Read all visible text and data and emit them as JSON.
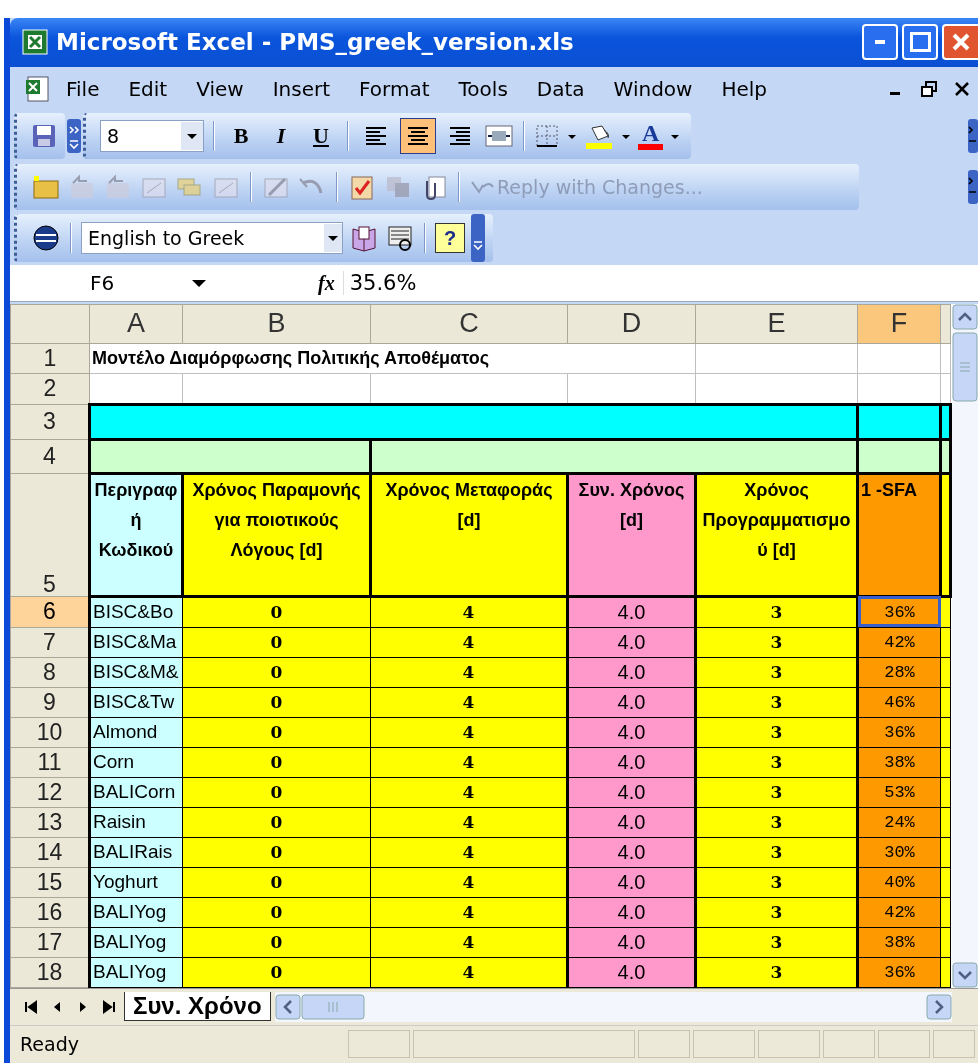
{
  "window": {
    "title": "Microsoft Excel - PMS_greek_version.xls"
  },
  "menu": [
    {
      "label": "File"
    },
    {
      "label": "Edit"
    },
    {
      "label": "View"
    },
    {
      "label": "Insert"
    },
    {
      "label": "Format"
    },
    {
      "label": "Tools"
    },
    {
      "label": "Data"
    },
    {
      "label": "Window"
    },
    {
      "label": "Help"
    }
  ],
  "formatting_toolbar": {
    "font_size": "8",
    "bold": "B",
    "italic": "I",
    "underline": "U",
    "alignment": [
      {
        "kind": "left",
        "selected": false
      },
      {
        "kind": "center",
        "selected": true
      },
      {
        "kind": "right",
        "selected": false
      }
    ],
    "font_color": "A"
  },
  "reviewing_toolbar": {
    "reply_button": {
      "label": "Reply with Changes...",
      "disabled": true
    }
  },
  "translation_toolbar": {
    "direction": "English to Greek",
    "help": "?"
  },
  "formula_bar": {
    "name_box": "F6",
    "fx": "fx",
    "formula": "35.6%"
  },
  "columns": [
    {
      "label": "A",
      "selected": false,
      "color": "#ccffff"
    },
    {
      "label": "B",
      "selected": false,
      "color": "#ffff00"
    },
    {
      "label": "C",
      "selected": false,
      "color": "#ffff00"
    },
    {
      "label": "D",
      "selected": false,
      "color": "#ff99cc"
    },
    {
      "label": "E",
      "selected": false,
      "color": "#ffff00"
    },
    {
      "label": "F",
      "selected": true,
      "color": "#ff9900"
    }
  ],
  "sheet_title": {
    "row": "1",
    "text": "Μοντέλο Διαμόρφωσης Πολιτικής Αποθέματος"
  },
  "blank_rows": [
    "2",
    "3",
    "4"
  ],
  "header_row": {
    "row": "5",
    "cells": [
      "Περιγραφή Κωδικού",
      "Χρόνος Παραμονής για ποιοτικούς Λόγους [d]",
      "Χρόνος Μεταφοράς [d]",
      "Συν. Χρόνος [d]",
      "Χρόνος Προγραμματισμού [d]",
      "1 -SFA"
    ]
  },
  "rows": [
    {
      "row": "6",
      "selected": true,
      "cells": [
        "BISC&Bo",
        "0",
        "4",
        "4.0",
        "3",
        "36%"
      ]
    },
    {
      "row": "7",
      "selected": false,
      "cells": [
        "BISC&Ma",
        "0",
        "4",
        "4.0",
        "3",
        "42%"
      ]
    },
    {
      "row": "8",
      "selected": false,
      "cells": [
        "BISC&M&",
        "0",
        "4",
        "4.0",
        "3",
        "28%"
      ]
    },
    {
      "row": "9",
      "selected": false,
      "cells": [
        "BISC&Tw",
        "0",
        "4",
        "4.0",
        "3",
        "46%"
      ]
    },
    {
      "row": "10",
      "selected": false,
      "cells": [
        "Almond",
        "0",
        "4",
        "4.0",
        "3",
        "36%"
      ]
    },
    {
      "row": "11",
      "selected": false,
      "cells": [
        "Corn",
        "0",
        "4",
        "4.0",
        "3",
        "38%"
      ]
    },
    {
      "row": "12",
      "selected": false,
      "cells": [
        "BALICorn",
        "0",
        "4",
        "4.0",
        "3",
        "53%"
      ]
    },
    {
      "row": "13",
      "selected": false,
      "cells": [
        "Raisin",
        "0",
        "4",
        "4.0",
        "3",
        "24%"
      ]
    },
    {
      "row": "14",
      "selected": false,
      "cells": [
        "BALIRais",
        "0",
        "4",
        "4.0",
        "3",
        "30%"
      ]
    },
    {
      "row": "15",
      "selected": false,
      "cells": [
        "Yoghurt",
        "0",
        "4",
        "4.0",
        "3",
        "40%"
      ]
    },
    {
      "row": "16",
      "selected": false,
      "cells": [
        "BALIYog",
        "0",
        "4",
        "4.0",
        "3",
        "42%"
      ]
    },
    {
      "row": "17",
      "selected": false,
      "cells": [
        "BALIYog",
        "0",
        "4",
        "4.0",
        "3",
        "38%"
      ]
    },
    {
      "row": "18",
      "selected": false,
      "cells": [
        "BALIYog",
        "0",
        "4",
        "4.0",
        "3",
        "36%"
      ]
    }
  ],
  "sheet_tabs": [
    {
      "label": "Συν. Χρόνο",
      "selected": true
    }
  ],
  "status_bar": {
    "text": "Ready"
  }
}
